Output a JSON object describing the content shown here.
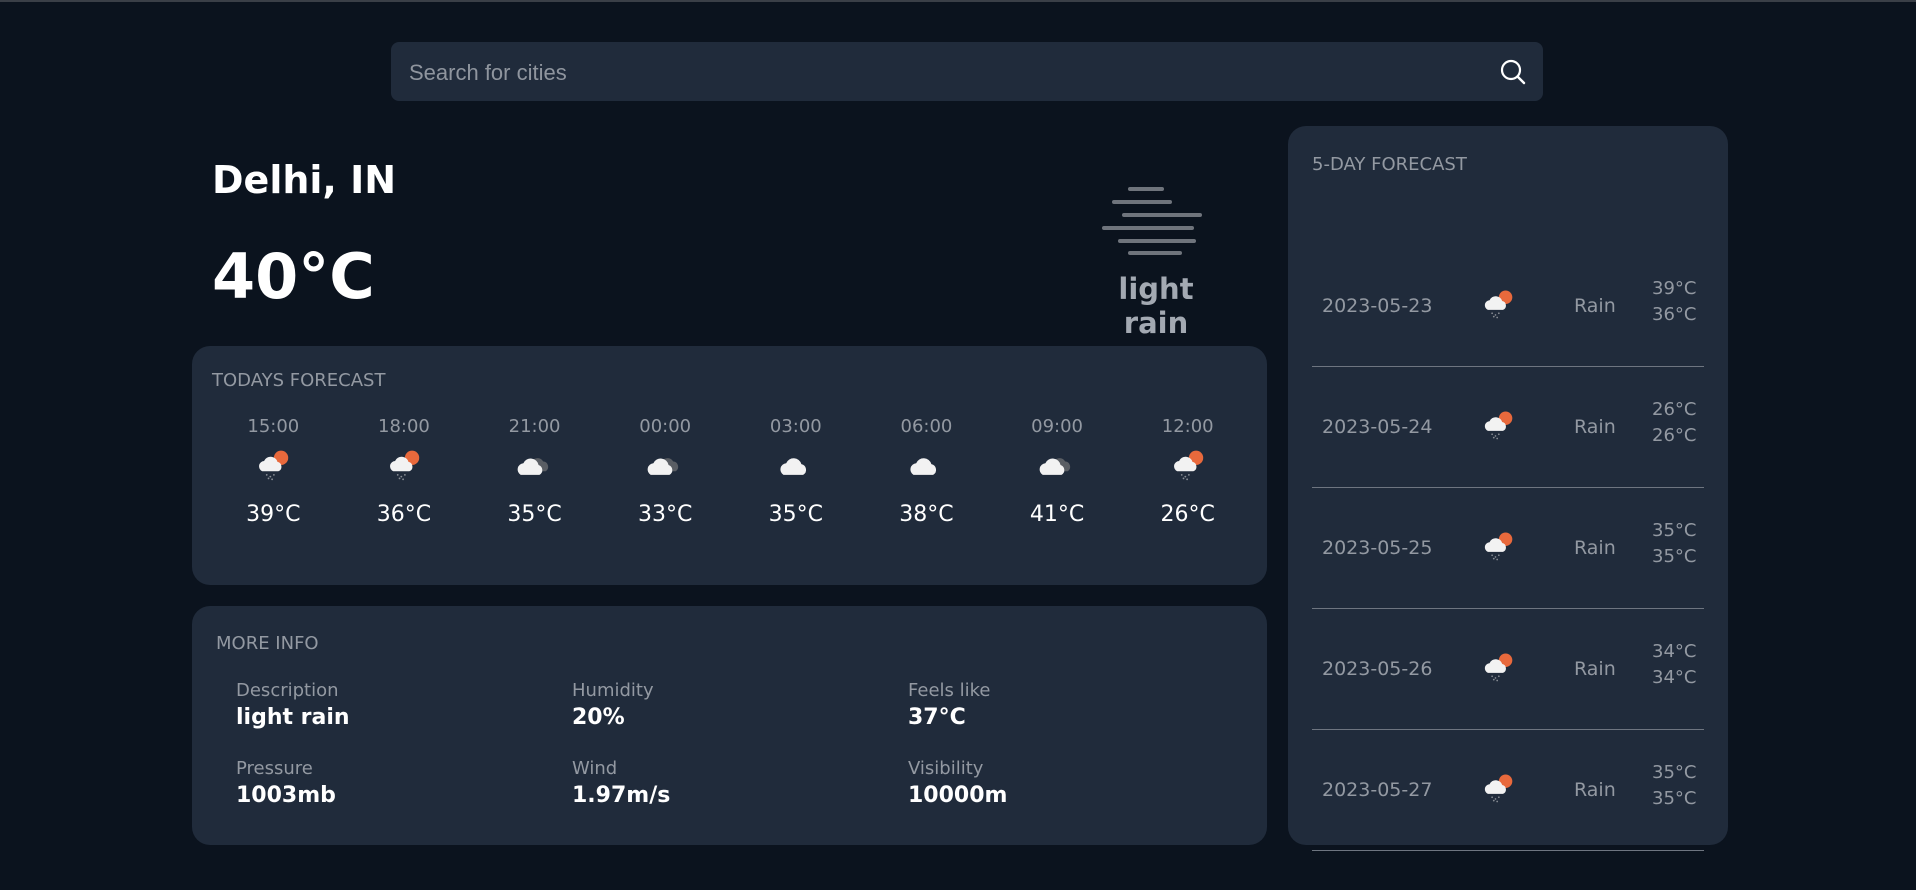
{
  "search": {
    "placeholder": "Search for cities",
    "value": "",
    "icon": "search-icon"
  },
  "current": {
    "city": "Delhi, IN",
    "temperature": "40°C",
    "description": "light rain",
    "icon": "mist-icon"
  },
  "today": {
    "title": "TODAYS FORECAST",
    "hours": [
      {
        "time": "15:00",
        "icon": "sun-cloud-rain-icon",
        "temp": "39°C"
      },
      {
        "time": "18:00",
        "icon": "sun-cloud-rain-icon",
        "temp": "36°C"
      },
      {
        "time": "21:00",
        "icon": "broken-clouds-icon",
        "temp": "35°C"
      },
      {
        "time": "00:00",
        "icon": "broken-clouds-icon",
        "temp": "33°C"
      },
      {
        "time": "03:00",
        "icon": "cloud-icon",
        "temp": "35°C"
      },
      {
        "time": "06:00",
        "icon": "cloud-icon",
        "temp": "38°C"
      },
      {
        "time": "09:00",
        "icon": "broken-clouds-icon",
        "temp": "41°C"
      },
      {
        "time": "12:00",
        "icon": "sun-cloud-rain-icon",
        "temp": "26°C"
      }
    ]
  },
  "more": {
    "title": "MORE INFO",
    "items": [
      {
        "label": "Description",
        "value": "light rain"
      },
      {
        "label": "Humidity",
        "value": "20%"
      },
      {
        "label": "Feels like",
        "value": "37°C"
      },
      {
        "label": "Pressure",
        "value": "1003mb"
      },
      {
        "label": "Wind",
        "value": "1.97m/s"
      },
      {
        "label": "Visibility",
        "value": "10000m"
      }
    ]
  },
  "five_day": {
    "title": "5-DAY FORECAST",
    "days": [
      {
        "date": "2023-05-23",
        "icon": "sun-cloud-rain-icon",
        "condition": "Rain",
        "high": "39°C",
        "low": "36°C"
      },
      {
        "date": "2023-05-24",
        "icon": "sun-cloud-rain-icon",
        "condition": "Rain",
        "high": "26°C",
        "low": "26°C"
      },
      {
        "date": "2023-05-25",
        "icon": "sun-cloud-rain-icon",
        "condition": "Rain",
        "high": "35°C",
        "low": "35°C"
      },
      {
        "date": "2023-05-26",
        "icon": "sun-cloud-rain-icon",
        "condition": "Rain",
        "high": "34°C",
        "low": "34°C"
      },
      {
        "date": "2023-05-27",
        "icon": "sun-cloud-rain-icon",
        "condition": "Rain",
        "high": "35°C",
        "low": "35°C"
      }
    ]
  },
  "colors": {
    "background": "#0b131e",
    "card": "#202b3b",
    "muted_text": "#9399a2",
    "sun": "#e8693c"
  }
}
